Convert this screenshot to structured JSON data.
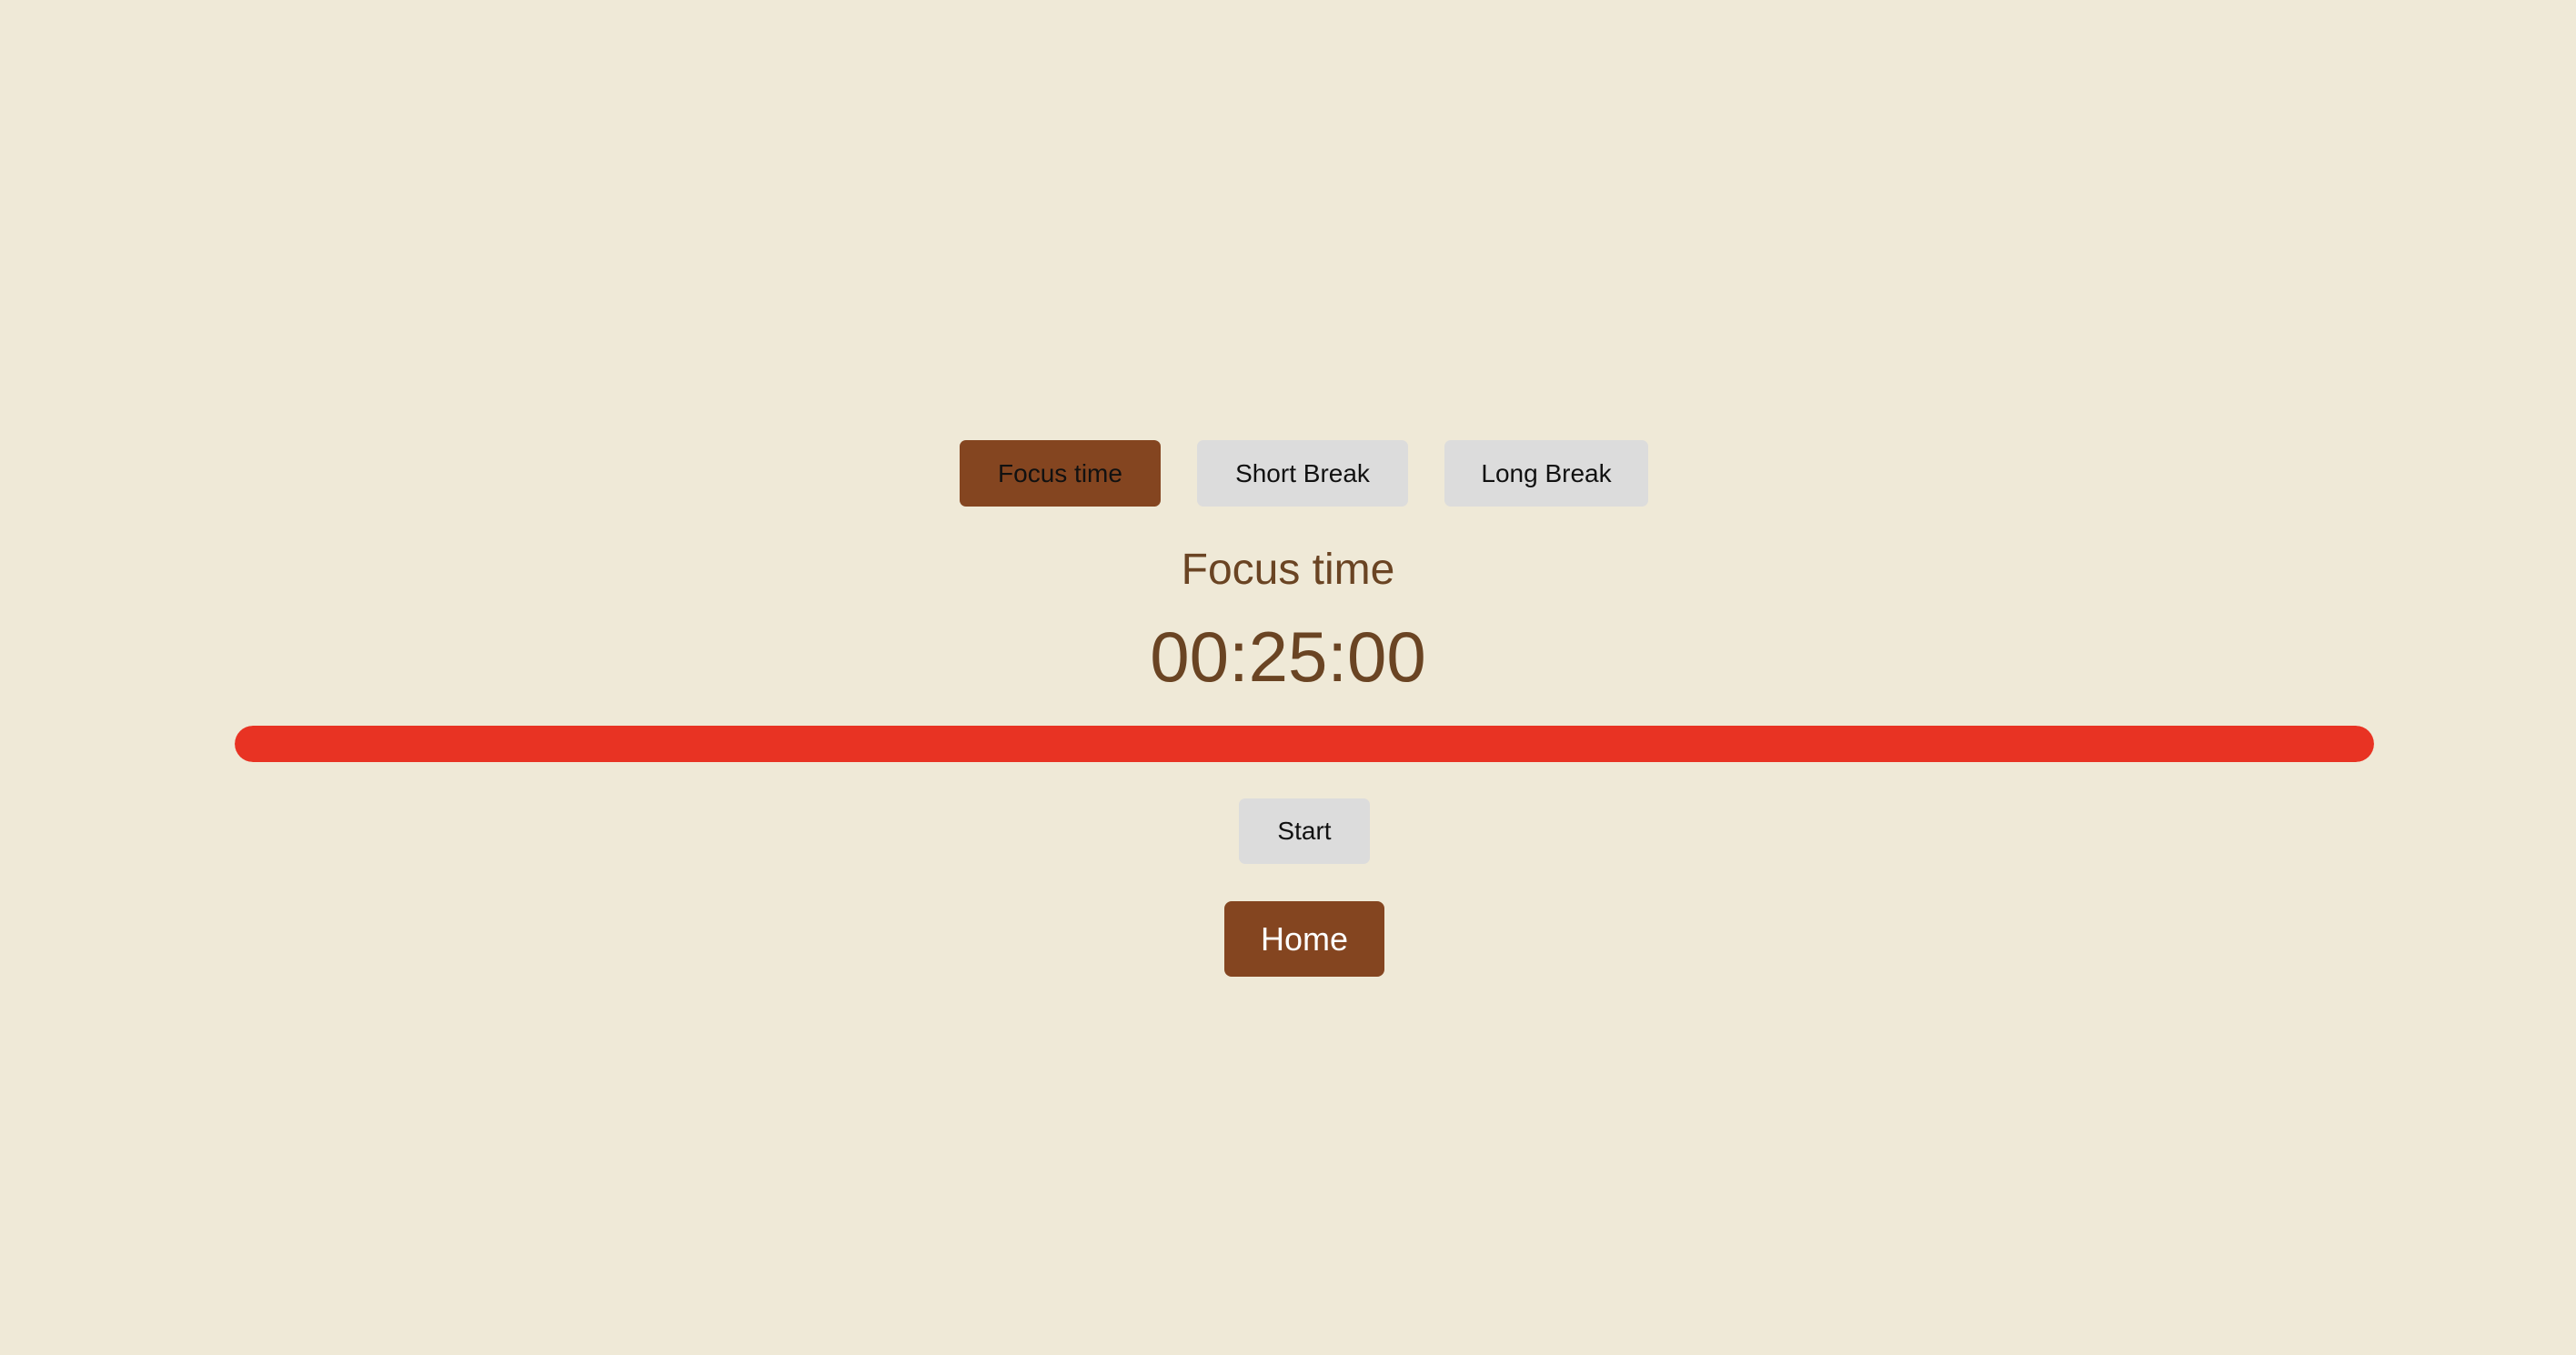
{
  "tabs": [
    {
      "label": "Focus time",
      "active": true
    },
    {
      "label": "Short Break",
      "active": false
    },
    {
      "label": "Long Break",
      "active": false
    }
  ],
  "mode_title": "Focus time",
  "timer": "00:25:00",
  "progress": 1.0,
  "controls": {
    "start_label": "Start",
    "home_label": "Home"
  },
  "colors": {
    "background": "#efe9d7",
    "accent": "#844520",
    "progress": "#e83323",
    "text": "#6a4423",
    "inactive_button": "#dcdcdc"
  }
}
